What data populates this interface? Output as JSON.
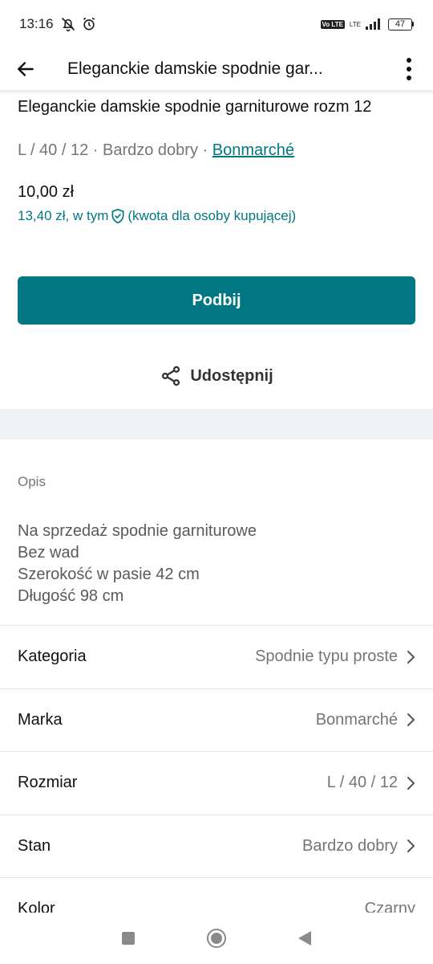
{
  "status_bar": {
    "time": "13:16",
    "network": "LTE",
    "volte": "Vo LTE",
    "battery": "47"
  },
  "app_bar": {
    "title": "Eleganckie damskie spodnie gar..."
  },
  "item": {
    "title": "Eleganckie damskie spodnie garniturowe rozm 12",
    "meta_size": "L / 40 / 12",
    "meta_condition": "Bardzo dobry",
    "meta_separator": " · ",
    "brand": "Bonmarché",
    "price": "10,00 zł",
    "buyer_price_prefix": "13,40 zł, w tym",
    "buyer_price_suffix": "(kwota dla osoby kupującej)"
  },
  "actions": {
    "bump_label": "Podbij",
    "share_label": "Udostępnij"
  },
  "description": {
    "heading": "Opis",
    "lines": [
      "Na sprzedaż spodnie garniturowe",
      "Bez wad",
      "Szerokość w pasie 42 cm",
      "Długość 98 cm"
    ]
  },
  "attributes": [
    {
      "label": "Kategoria",
      "value": "Spodnie typu proste"
    },
    {
      "label": "Marka",
      "value": "Bonmarché"
    },
    {
      "label": "Rozmiar",
      "value": "L / 40 / 12"
    },
    {
      "label": "Stan",
      "value": "Bardzo dobry"
    },
    {
      "label": "Kolor",
      "value": "Czarny"
    }
  ],
  "colors": {
    "accent": "#007782",
    "divider_band": "#eef2f2",
    "muted_text": "#757575"
  },
  "icons": {
    "back": "arrow-left-icon",
    "more": "more-vertical-icon",
    "share": "share-icon",
    "shield": "shield-check-icon",
    "chevron": "chevron-right-icon"
  }
}
